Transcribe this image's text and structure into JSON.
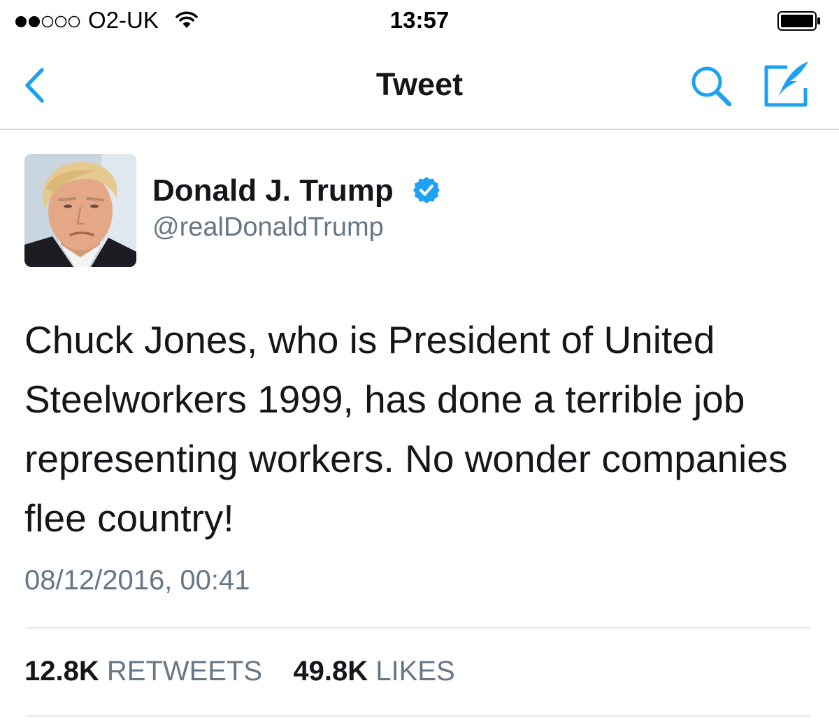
{
  "colors": {
    "accent": "#1da1f2",
    "text_primary": "#14171a",
    "text_secondary": "#657786",
    "divider": "#e1e8ed"
  },
  "status_bar": {
    "signal_strength_filled": 2,
    "signal_strength_total": 5,
    "carrier": "O2-UK",
    "time": "13:57",
    "icons": [
      "wifi-icon",
      "battery-icon"
    ]
  },
  "nav": {
    "title": "Tweet",
    "icons": [
      "back-chevron-icon",
      "search-icon",
      "compose-icon"
    ]
  },
  "tweet": {
    "author_name": "Donald J. Trump",
    "handle": "@realDonaldTrump",
    "verified": true,
    "text": "Chuck Jones, who is President of United Steelworkers 1999, has done a terrible job representing workers. No wonder companies flee country!",
    "timestamp": "08/12/2016, 00:41",
    "retweets_count": "12.8K",
    "retweets_label": "RETWEETS",
    "likes_count": "49.8K",
    "likes_label": "LIKES"
  }
}
